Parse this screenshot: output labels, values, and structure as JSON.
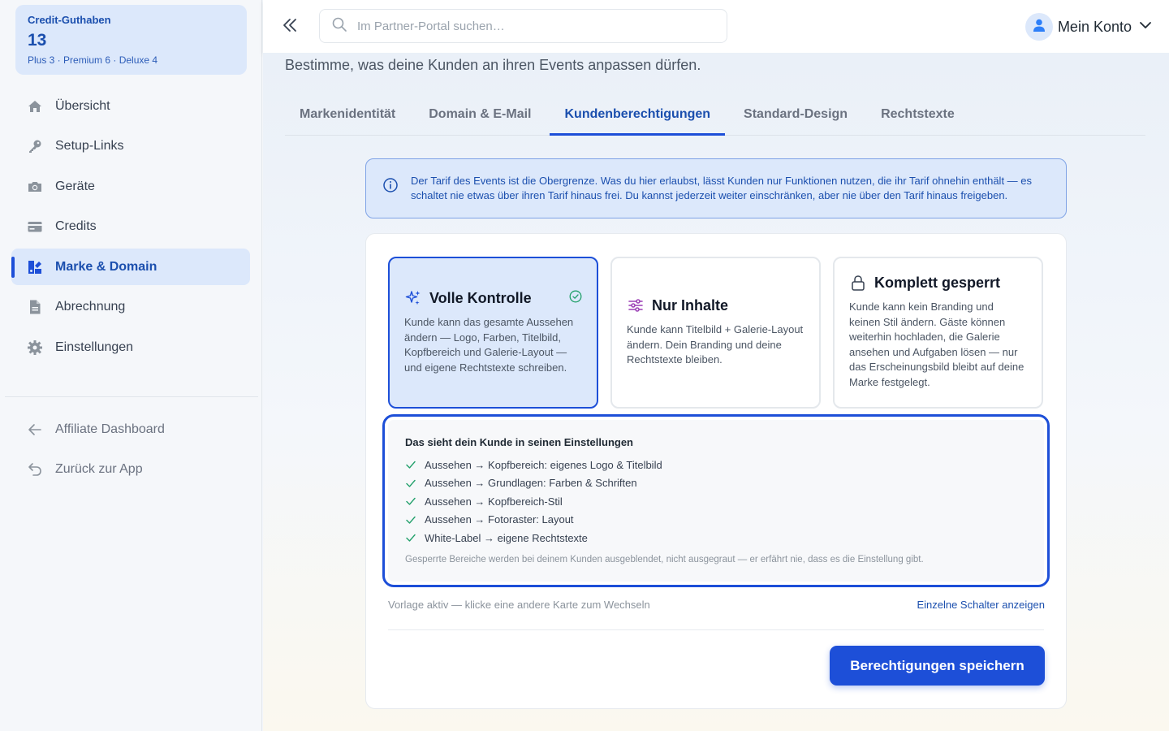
{
  "sidebar": {
    "credits": {
      "title": "Credit-Guthaben",
      "count": "13",
      "breakdown": "Plus 3 · Premium 6 · Deluxe 4"
    },
    "items": [
      {
        "label": "Übersicht",
        "icon": "home-icon"
      },
      {
        "label": "Setup-Links",
        "icon": "key-icon"
      },
      {
        "label": "Geräte",
        "icon": "camera-icon"
      },
      {
        "label": "Credits",
        "icon": "credit-card-icon"
      },
      {
        "label": "Marke & Domain",
        "icon": "brand-icon",
        "active": true
      },
      {
        "label": "Abrechnung",
        "icon": "document-icon"
      },
      {
        "label": "Einstellungen",
        "icon": "gear-icon"
      }
    ],
    "secondary": [
      {
        "label": "Affiliate Dashboard",
        "icon": "arrow-left-icon"
      },
      {
        "label": "Zurück zur App",
        "icon": "return-icon"
      }
    ]
  },
  "topbar": {
    "search_placeholder": "Im Partner-Portal suchen…",
    "account_label": "Mein Konto"
  },
  "main": {
    "subtitle": "Bestimme, was deine Kunden an ihren Events anpassen dürfen.",
    "tabs": [
      {
        "label": "Markenidentität"
      },
      {
        "label": "Domain & E-Mail"
      },
      {
        "label": "Kundenberechtigungen",
        "active": true
      },
      {
        "label": "Standard-Design"
      },
      {
        "label": "Rechtstexte"
      }
    ],
    "info_text": "Der Tarif des Events ist die Obergrenze. Was du hier erlaubst, lässt Kunden nur Funktionen nutzen, die ihr Tarif ohnehin enthält — es schaltet nie etwas über ihren Tarif hinaus frei. Du kannst jederzeit weiter einschränken, aber nie über den Tarif hinaus freigeben.",
    "cards": [
      {
        "title": "Volle Kontrolle",
        "icon": "sparkles-icon",
        "selected": true,
        "desc": "Kunde kann das gesamte Aussehen ändern — Logo, Farben, Titelbild, Kopfbereich und Galerie-Layout — und eigene Rechtstexte schreiben."
      },
      {
        "title": "Nur Inhalte",
        "icon": "sliders-icon",
        "desc": "Kunde kann Titelbild + Galerie-Layout ändern. Dein Branding und deine Rechtstexte bleiben."
      },
      {
        "title": "Komplett gesperrt",
        "icon": "lock-icon",
        "desc": "Kunde kann kein Branding und keinen Stil ändern. Gäste können weiterhin hochladen, die Galerie ansehen und Aufgaben lösen — nur das Erscheinungsbild bleibt auf deine Marke festgelegt."
      }
    ],
    "preview": {
      "title": "Das sieht dein Kunde in seinen Einstellungen",
      "items": [
        "Aussehen → Kopfbereich: eigenes Logo & Titelbild",
        "Aussehen → Grundlagen: Farben & Schriften",
        "Aussehen → Kopfbereich-Stil",
        "Aussehen → Fotoraster: Layout",
        "White-Label → eigene Rechtstexte"
      ],
      "note": "Gesperrte Bereiche werden bei deinem Kunden ausgeblendet, nicht ausgegraut — er erfährt nie, dass es die Einstellung gibt."
    },
    "footer_hint": "Vorlage aktiv — klicke eine andere Karte zum Wechseln",
    "footer_link": "Einzelne Schalter anzeigen",
    "save_label": "Berechtigungen speichern"
  },
  "colors": {
    "accent": "#1d4fd8",
    "accent_text": "#1b4fae",
    "accent_bg": "#dce8fb",
    "success": "#22a06b",
    "sliders_icon": "#9b3fb5"
  }
}
